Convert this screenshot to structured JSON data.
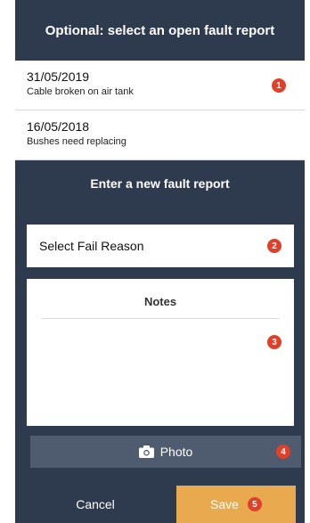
{
  "header": {
    "title": "Optional: select an open fault report"
  },
  "reports": [
    {
      "date": "31/05/2019",
      "description": "Cable broken on air tank",
      "badge": "1"
    },
    {
      "date": "16/05/2018",
      "description": "Bushes need replacing"
    }
  ],
  "new_report": {
    "title": "Enter a new fault report",
    "fail_reason_label": "Select Fail Reason",
    "fail_reason_badge": "2",
    "notes_label": "Notes",
    "notes_badge": "3"
  },
  "photo": {
    "label": "Photo",
    "badge": "4",
    "icon": "camera-icon"
  },
  "footer": {
    "cancel_label": "Cancel",
    "save_label": "Save",
    "save_badge": "5"
  },
  "colors": {
    "background": "#2e3a4e",
    "badge": "#e0402a",
    "save_button": "#e8a94f",
    "photo_button": "#4f5b6e"
  }
}
